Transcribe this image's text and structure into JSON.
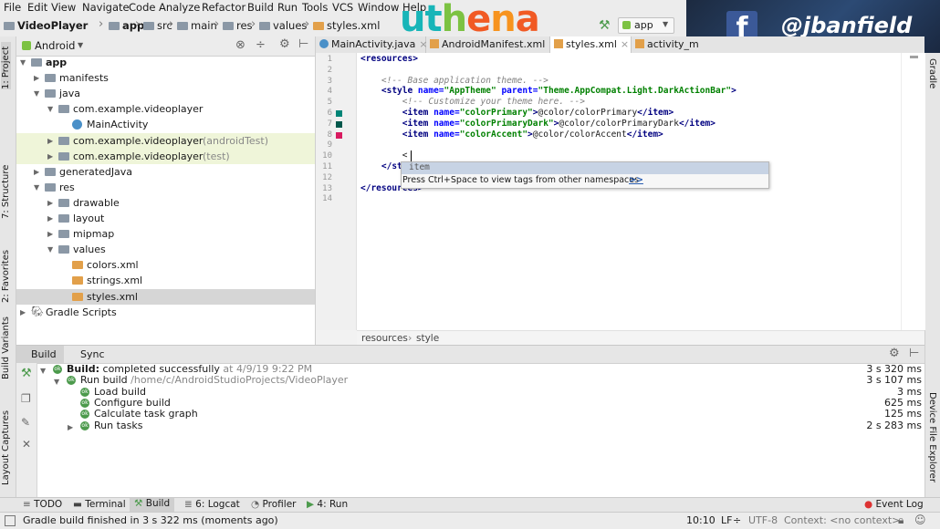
{
  "menu": [
    "File",
    "Edit",
    "View",
    "Navigate",
    "Code",
    "Analyze",
    "Refactor",
    "Build",
    "Run",
    "Tools",
    "VCS",
    "Window",
    "Help"
  ],
  "nav": {
    "breadcrumbs": [
      "VideoPlayer",
      "app",
      "src",
      "main",
      "res",
      "values",
      "styles.xml"
    ],
    "run_config": "app"
  },
  "logo": {
    "text": "uthena",
    "letters": [
      "u",
      "t",
      "h",
      "e",
      "n",
      "a"
    ],
    "colors": [
      "#18b5b8",
      "#18b5b8",
      "#7cc242",
      "#f15a24",
      "#f7931e",
      "#f15a24"
    ]
  },
  "banner": {
    "handle": "@jbanfield",
    "brand_color": "#3b5998"
  },
  "left_tabs": [
    "1: Project",
    "7: Structure",
    "2: Favorites",
    "Build Variants",
    "Layout Captures"
  ],
  "right_tabs": [
    "Gradle",
    "Device File Explorer"
  ],
  "project": {
    "view_selector": "Android",
    "tree": [
      {
        "label": "app",
        "level": 0,
        "icon": "folder",
        "expanded": true
      },
      {
        "label": "manifests",
        "level": 1,
        "icon": "folder",
        "expanded": false
      },
      {
        "label": "java",
        "level": 1,
        "icon": "folder",
        "expanded": true
      },
      {
        "label": "com.example.videoplayer",
        "level": 2,
        "icon": "package",
        "expanded": true
      },
      {
        "label": "MainActivity",
        "level": 3,
        "icon": "class"
      },
      {
        "label": "com.example.videoplayer",
        "suffix": " (androidTest)",
        "level": 2,
        "icon": "package",
        "expanded": false,
        "highlight": true
      },
      {
        "label": "com.example.videoplayer",
        "suffix": " (test)",
        "level": 2,
        "icon": "package",
        "expanded": false,
        "highlight": true
      },
      {
        "label": "generatedJava",
        "level": 1,
        "icon": "folder",
        "expanded": false
      },
      {
        "label": "res",
        "level": 1,
        "icon": "folder",
        "expanded": true
      },
      {
        "label": "drawable",
        "level": 2,
        "icon": "folder",
        "expanded": false
      },
      {
        "label": "layout",
        "level": 2,
        "icon": "folder",
        "expanded": false
      },
      {
        "label": "mipmap",
        "level": 2,
        "icon": "folder",
        "expanded": false
      },
      {
        "label": "values",
        "level": 2,
        "icon": "folder",
        "expanded": true
      },
      {
        "label": "colors.xml",
        "level": 3,
        "icon": "xml"
      },
      {
        "label": "strings.xml",
        "level": 3,
        "icon": "xml"
      },
      {
        "label": "styles.xml",
        "level": 3,
        "icon": "xml",
        "selected": true
      },
      {
        "label": "Gradle Scripts",
        "level": 0,
        "icon": "gradle",
        "expanded": false
      }
    ]
  },
  "editor": {
    "tabs": [
      "MainActivity.java",
      "AndroidManifest.xml",
      "styles.xml",
      "activity_m"
    ],
    "active_tab": 2,
    "line_numbers": [
      "1",
      "2",
      "3",
      "4",
      "5",
      "6",
      "7",
      "8",
      "9",
      "10",
      "11",
      "12",
      "13",
      "14"
    ],
    "color_swatches": [
      "#008577",
      "#00574B",
      "#D81B60"
    ],
    "lines": [
      [
        [
          "tag",
          "<resources>"
        ]
      ],
      [],
      [
        [
          "cmt",
          "    <!-- Base application theme. -->"
        ]
      ],
      [
        [
          "tag",
          "    <style "
        ],
        [
          "attr",
          "name="
        ],
        [
          "str",
          "\"AppTheme\" "
        ],
        [
          "attr",
          "parent="
        ],
        [
          "str",
          "\"Theme.AppCompat.Light.DarkActionBar\""
        ],
        [
          "tag",
          ">"
        ]
      ],
      [
        [
          "cmt",
          "        <!-- Customize your theme here. -->"
        ]
      ],
      [
        [
          "tag",
          "        <item "
        ],
        [
          "attr",
          "name="
        ],
        [
          "str",
          "\"colorPrimary\""
        ],
        [
          "tag",
          ">"
        ],
        [
          "plain",
          "@color/colorPrimary"
        ],
        [
          "tag",
          "</item>"
        ]
      ],
      [
        [
          "tag",
          "        <item "
        ],
        [
          "attr",
          "name="
        ],
        [
          "str",
          "\"colorPrimaryDark\""
        ],
        [
          "tag",
          ">"
        ],
        [
          "plain",
          "@color/colorPrimaryDark"
        ],
        [
          "tag",
          "</item>"
        ]
      ],
      [
        [
          "tag",
          "        <item "
        ],
        [
          "attr",
          "name="
        ],
        [
          "str",
          "\"colorAccent\""
        ],
        [
          "tag",
          ">"
        ],
        [
          "plain",
          "@color/colorAccent"
        ],
        [
          "tag",
          "</item>"
        ]
      ],
      [],
      [
        [
          "plain",
          "        <"
        ]
      ],
      [
        [
          "tag",
          "    </st"
        ]
      ],
      [],
      [
        [
          "tag",
          "</resources>"
        ]
      ],
      []
    ],
    "completion": {
      "item": "item",
      "hint": "Press Ctrl+Space to view tags from other namespaces",
      "more": ">>"
    },
    "breadcrumb": [
      "resources",
      "style"
    ]
  },
  "build": {
    "tabs": [
      "Build",
      "Sync"
    ],
    "rows": [
      {
        "level": 0,
        "bold": "Build:",
        "text": " completed successfully",
        "extra": " at 4/9/19 9:22 PM",
        "time": "3 s 320 ms"
      },
      {
        "level": 1,
        "bold": "",
        "text": "Run build",
        "extra": " /home/c/AndroidStudioProjects/VideoPlayer",
        "time": "3 s 107 ms"
      },
      {
        "level": 2,
        "bold": "",
        "text": "Load build",
        "extra": "",
        "time": "3 ms"
      },
      {
        "level": 2,
        "bold": "",
        "text": "Configure build",
        "extra": "",
        "time": "625 ms"
      },
      {
        "level": 2,
        "bold": "",
        "text": "Calculate task graph",
        "extra": "",
        "time": "125 ms"
      },
      {
        "level": 2,
        "bold": "",
        "text": "Run tasks",
        "extra": "",
        "time": "2 s 283 ms"
      }
    ]
  },
  "bottom_tabs": [
    "TODO",
    "Terminal",
    "Build",
    "6: Logcat",
    "Profiler",
    "4: Run"
  ],
  "event_log": "Event Log",
  "status": {
    "message": "Gradle build finished in 3 s 322 ms (moments ago)",
    "position": "10:10",
    "line_sep": "LF",
    "encoding": "UTF-8",
    "context": "Context: <no context>"
  }
}
